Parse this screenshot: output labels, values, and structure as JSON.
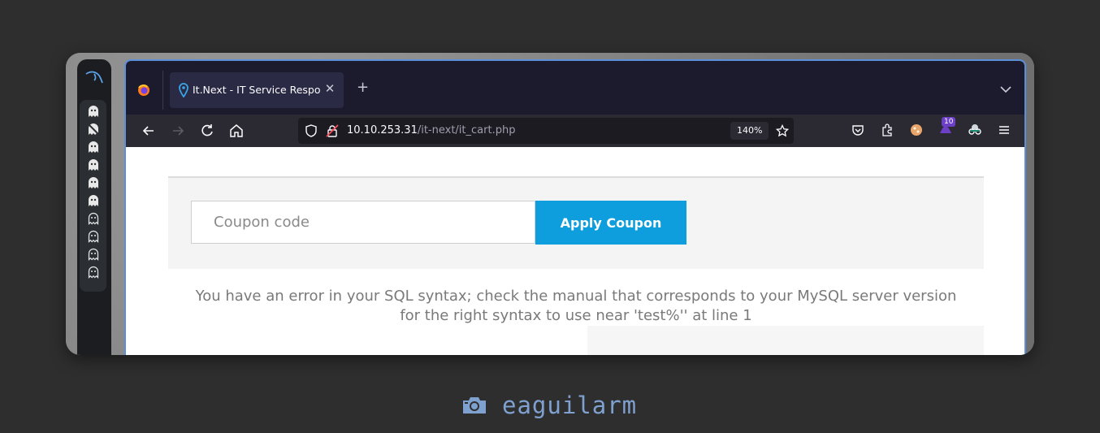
{
  "browser": {
    "tab": {
      "title": "It.Next - IT Service Respo",
      "close_icon": "close-icon",
      "favicon": "location-pin-icon"
    },
    "new_tab_icon": "plus-icon",
    "url": {
      "host": "10.10.253.31",
      "path": "/it-next/it_cart.php"
    },
    "zoom": "140%",
    "extension_badge": "10"
  },
  "page": {
    "coupon_placeholder": "Coupon code",
    "apply_label": "Apply Coupon",
    "error_line1": "You have an error in your SQL syntax; check the manual that corresponds to your MySQL server version",
    "error_line2": "for the right syntax to use near 'test%'' at line 1"
  },
  "footer": {
    "username": "eaguilarm",
    "icon": "camera-icon"
  },
  "colors": {
    "accent": "#0e9ddd",
    "tabbar": "#1c1b2e",
    "footer_text": "#7fa1cf"
  }
}
